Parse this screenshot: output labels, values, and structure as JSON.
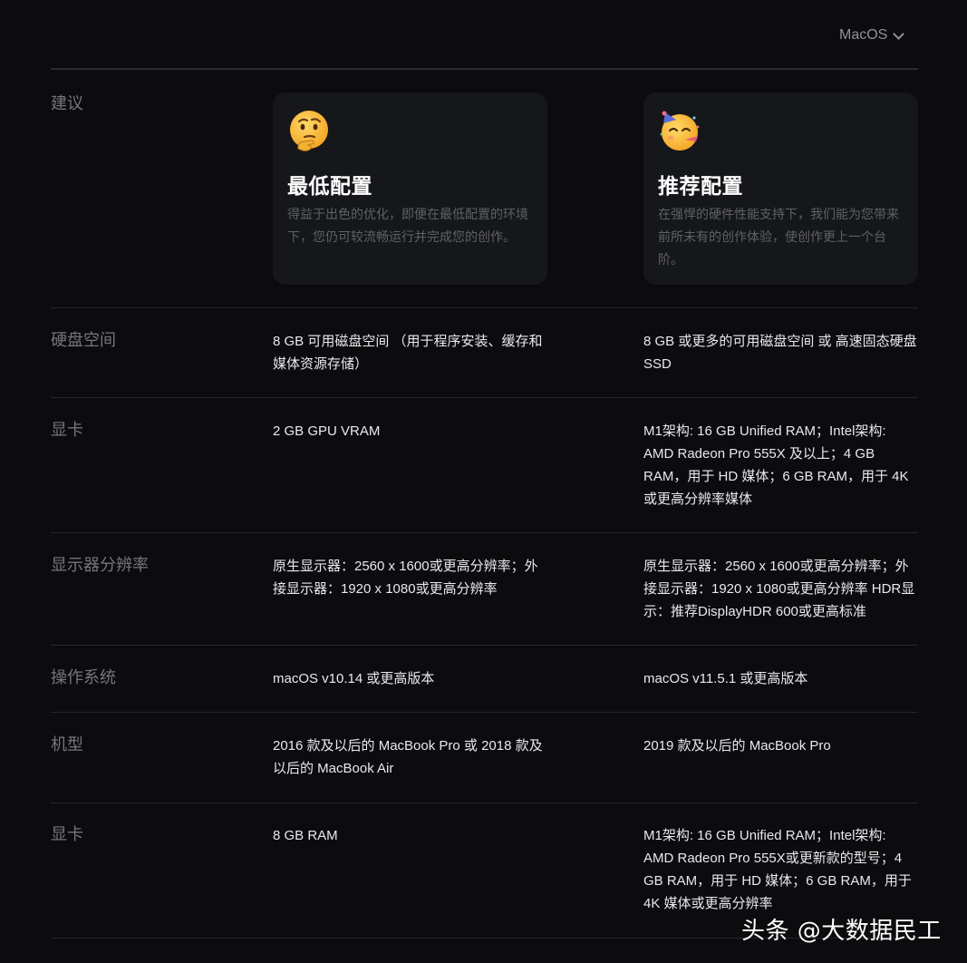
{
  "header": {
    "os_select": "MacOS"
  },
  "columns": {
    "minimum": {
      "title": "最低配置",
      "description": "得益于出色的优化，即便在最低配置的环境下，您仍可较流畅运行并完成您的创作。",
      "emoji": "thinking-face-icon"
    },
    "recommended": {
      "title": "推荐配置",
      "description": "在强悍的硬件性能支持下，我们能为您带来前所未有的创作体验，使创作更上一个台阶。",
      "emoji": "partying-face-icon"
    }
  },
  "rows": [
    {
      "label": "建议"
    },
    {
      "label": "硬盘空间",
      "min": "8 GB 可用磁盘空间 （用于程序安装、缓存和媒体资源存储）",
      "rec": "8 GB 或更多的可用磁盘空间 或 高速固态硬盘 SSD"
    },
    {
      "label": "显卡",
      "min": "2 GB GPU VRAM",
      "rec": "M1架构: 16 GB Unified RAM；Intel架构: AMD Radeon Pro 555X 及以上；4 GB RAM，用于 HD 媒体；6 GB RAM，用于 4K 或更高分辨率媒体"
    },
    {
      "label": "显示器分辨率",
      "min": "原生显示器：2560 x 1600或更高分辨率；外接显示器：1920 x 1080或更高分辨率",
      "rec": "原生显示器：2560 x 1600或更高分辨率；外接显示器：1920 x 1080或更高分辨率 HDR显示：推荐DisplayHDR 600或更高标准"
    },
    {
      "label": "操作系统",
      "min": "macOS v10.14 或更高版本",
      "rec": "macOS v11.5.1 或更高版本"
    },
    {
      "label": "机型",
      "min": "2016 款及以后的 MacBook Pro 或 2018 款及以后的 MacBook Air",
      "rec": "2019 款及以后的 MacBook Pro"
    },
    {
      "label": "显卡",
      "min": "8 GB RAM",
      "rec": "M1架构: 16 GB Unified RAM；Intel架构: AMD Radeon Pro 555X或更新款的型号；4 GB RAM，用于 HD 媒体；6 GB RAM，用于 4K 媒体或更高分辨率"
    }
  ],
  "watermark": "头条 @大数据民工"
}
